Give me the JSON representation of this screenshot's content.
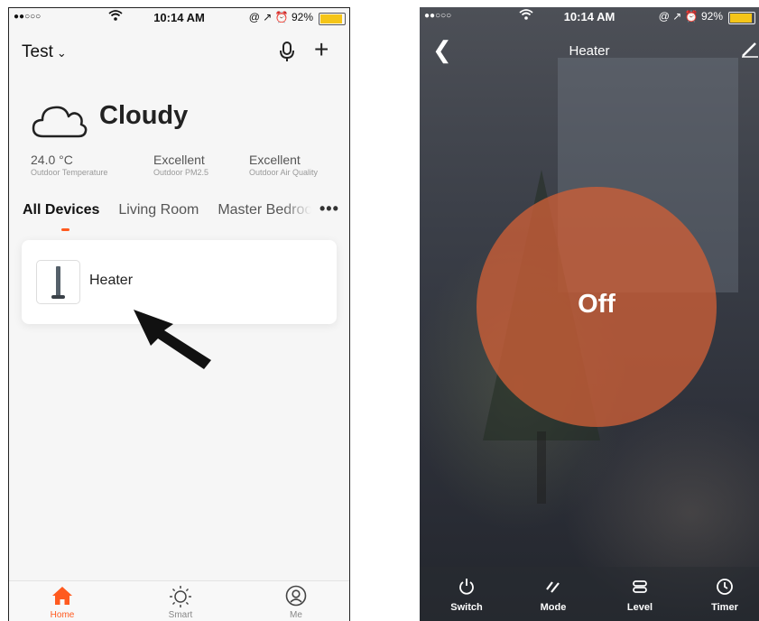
{
  "status_bar": {
    "signal": "●●○○○",
    "time": "10:14 AM",
    "indicators": "@ ↗ ⏰",
    "battery": "92%"
  },
  "home": {
    "title": "Test",
    "weather": {
      "condition": "Cloudy"
    },
    "stats": [
      {
        "value": "24.0 °C",
        "label": "Outdoor Temperature"
      },
      {
        "value": "Excellent",
        "label": "Outdoor PM2.5"
      },
      {
        "value": "Excellent",
        "label": "Outdoor Air Quality"
      }
    ],
    "tabs": [
      "All Devices",
      "Living Room",
      "Master Bedroo"
    ],
    "devices": [
      {
        "name": "Heater"
      }
    ],
    "tabbar": [
      {
        "label": "Home",
        "icon": "home-icon"
      },
      {
        "label": "Smart",
        "icon": "sun-icon"
      },
      {
        "label": "Me",
        "icon": "profile-icon"
      }
    ]
  },
  "device": {
    "title": "Heater",
    "state": "Off",
    "controls": [
      {
        "label": "Switch",
        "icon": "power-icon"
      },
      {
        "label": "Mode",
        "icon": "mode-icon"
      },
      {
        "label": "Level",
        "icon": "level-icon"
      },
      {
        "label": "Timer",
        "icon": "clock-icon"
      }
    ]
  },
  "colors": {
    "accent": "#ff5a1f",
    "orb": "#cd5f37",
    "battery": "#f5c518"
  }
}
